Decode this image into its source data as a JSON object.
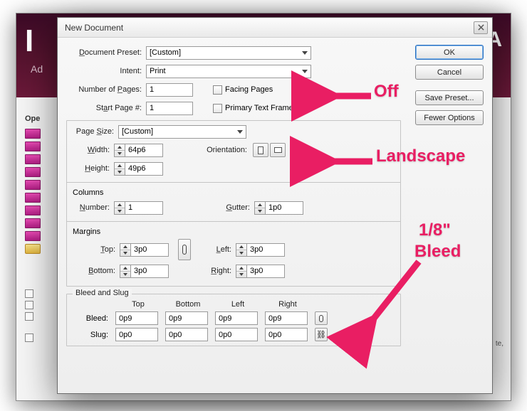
{
  "background": {
    "logo_fragment": "I",
    "brand_fragment": "Ad",
    "decor_right": "A",
    "section_open": "Ope",
    "bottom_right_fragment": "te,"
  },
  "dialog": {
    "title": "New Document",
    "labels": {
      "doc_preset": "Document Preset:",
      "intent": "Intent:",
      "num_pages": "Number of Pages:",
      "start_page": "Start Page #:",
      "facing_pages": "Facing Pages",
      "primary_text_frame": "Primary Text Frame",
      "page_size": "Page Size:",
      "width": "Width:",
      "height": "Height:",
      "orientation": "Orientation:",
      "columns": "Columns",
      "col_number": "Number:",
      "gutter": "Gutter:",
      "margins": "Margins",
      "top": "Top:",
      "bottom": "Bottom:",
      "left": "Left:",
      "right": "Right:",
      "bleed_slug": "Bleed and Slug",
      "bleed": "Bleed:",
      "slug": "Slug:"
    },
    "values": {
      "doc_preset": "[Custom]",
      "intent": "Print",
      "num_pages": "1",
      "start_page": "1",
      "facing_pages_checked": false,
      "primary_text_frame_checked": false,
      "page_size": "[Custom]",
      "width": "64p6",
      "height": "49p6",
      "col_number": "1",
      "gutter": "1p0",
      "margin_top": "3p0",
      "margin_bottom": "3p0",
      "margin_left": "3p0",
      "margin_right": "3p0",
      "bleed": {
        "top": "0p9",
        "bottom": "0p9",
        "left": "0p9",
        "right": "0p9"
      },
      "slug": {
        "top": "0p0",
        "bottom": "0p0",
        "left": "0p0",
        "right": "0p0"
      }
    },
    "buttons": {
      "ok": "OK",
      "cancel": "Cancel",
      "save_preset": "Save Preset...",
      "fewer_options": "Fewer Options"
    },
    "bs_headers": {
      "top": "Top",
      "bottom": "Bottom",
      "left": "Left",
      "right": "Right"
    }
  },
  "annotations": {
    "off": "Off",
    "landscape": "Landscape",
    "bleed1": "1/8\"",
    "bleed2": "Bleed"
  }
}
